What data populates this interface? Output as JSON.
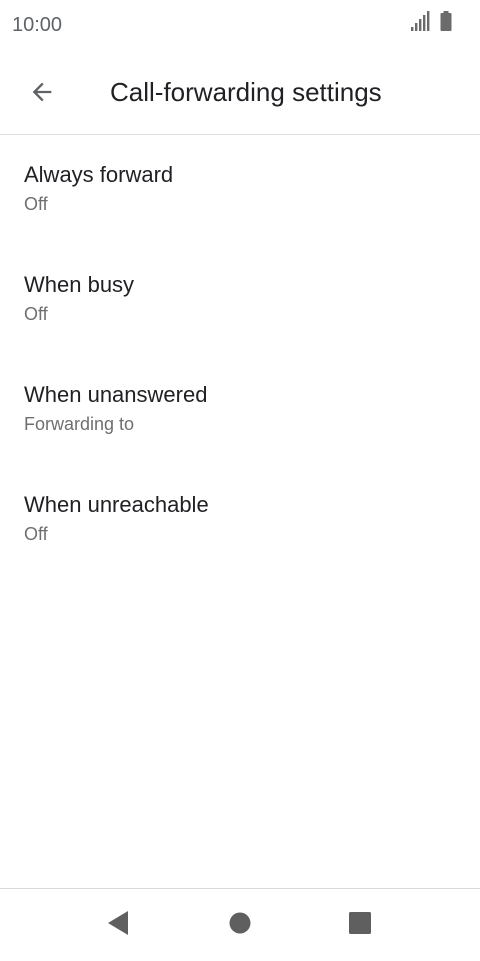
{
  "status_bar": {
    "time": "10:00",
    "icons": [
      "signal-icon",
      "battery-icon"
    ]
  },
  "app_bar": {
    "back_icon": "arrow-back-icon",
    "title": "Call-forwarding settings"
  },
  "settings": {
    "items": [
      {
        "title": "Always forward",
        "summary": "Off"
      },
      {
        "title": "When busy",
        "summary": "Off"
      },
      {
        "title": "When unanswered",
        "summary": "Forwarding to"
      },
      {
        "title": "When unreachable",
        "summary": "Off"
      }
    ]
  },
  "nav_bar": {
    "buttons": [
      "back-triangle-icon",
      "home-circle-icon",
      "recents-square-icon"
    ]
  },
  "colors": {
    "text_primary": "#202124",
    "text_secondary": "#6f6f6f",
    "icon_gray": "#5f6368",
    "divider": "#e0e0e0"
  }
}
